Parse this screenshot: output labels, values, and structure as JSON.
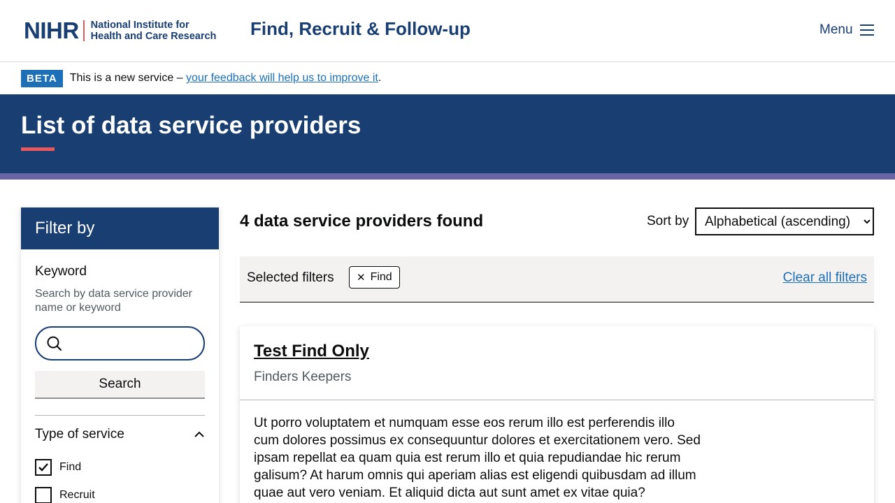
{
  "header": {
    "logo_mark": "NIHR",
    "logo_line1": "National Institute for",
    "logo_line2": "Health and Care Research",
    "service_name": "Find, Recruit & Follow-up",
    "menu_label": "Menu"
  },
  "beta": {
    "tag": "BETA",
    "text_before": "This is a new service – ",
    "link": "your feedback will help us to improve it",
    "text_after": "."
  },
  "hero": {
    "title": "List of data service providers"
  },
  "sidebar": {
    "heading": "Filter by",
    "keyword_label": "Keyword",
    "keyword_hint": "Search by data service provider name or keyword",
    "search_value": "",
    "search_button": "Search",
    "type_heading": "Type of service",
    "options": [
      {
        "label": "Find",
        "checked": true
      },
      {
        "label": "Recruit",
        "checked": false
      }
    ]
  },
  "results": {
    "count_text": "4 data service providers found",
    "sort_label": "Sort by",
    "sort_selected": "Alphabetical (ascending)",
    "selected_filters_label": "Selected filters",
    "chips": [
      "Find"
    ],
    "clear_all": "Clear all filters"
  },
  "cards": [
    {
      "title": "Test Find Only",
      "org": "Finders Keepers",
      "body": "Ut porro voluptatem et numquam esse eos rerum illo est perferendis illo cum dolores possimus ex consequuntur dolores et exercitationem vero. Sed ipsam repellat ea quam quia est rerum illo et quia repudiandae hic rerum galisum? At harum omnis qui aperiam alias est eligendi quibusdam ad illum quae aut vero veniam. Et aliquid dicta aut sunt amet ex vitae quia?"
    }
  ],
  "colors": {
    "brand_navy": "#193e72",
    "accent_coral": "#e9585c",
    "link_blue": "#1d70b8",
    "strip_purple": "#6865a6"
  },
  "icons": {
    "menu": "hamburger-icon",
    "search": "search-icon",
    "chevron": "chevron-up-icon",
    "checkbox": "checkmark-icon",
    "chip_remove": "close-icon"
  }
}
